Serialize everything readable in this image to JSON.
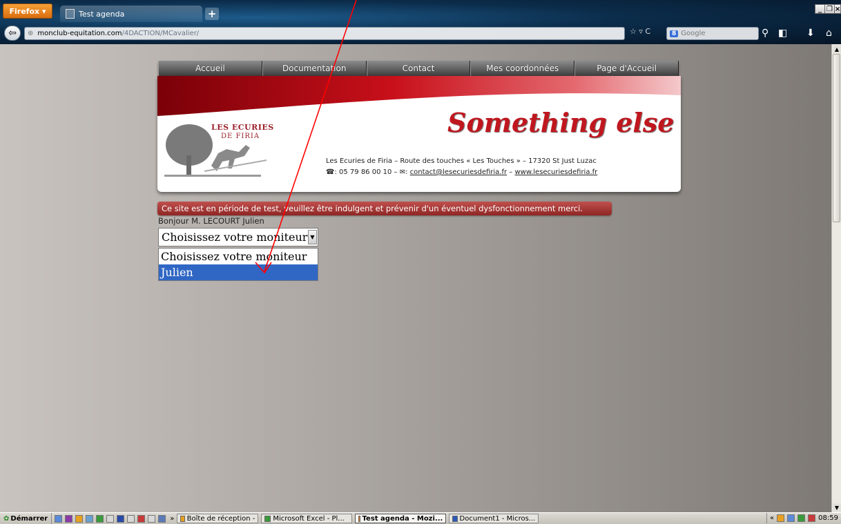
{
  "browser": {
    "menu_button": "Firefox",
    "tab_title": "Test agenda",
    "url_domain": "monclub-equitation.com",
    "url_path": "/4DACTION/MCavalier/",
    "search_placeholder": "Google"
  },
  "nav": {
    "items": [
      "Accueil",
      "Documentation",
      "Contact",
      "Mes coordonnées",
      "Page d'Accueil"
    ]
  },
  "banner": {
    "logo_line1": "LES ECURIES",
    "logo_line2": "DE FIRIA",
    "slogan": "Something else",
    "address": "Les Ecuries de Firia – Route des touches « Les Touches » – 17320 St Just Luzac",
    "phone": ": 05 79 86 00 10 – ",
    "email": "contact@lesecuriesdefiria.fr",
    "dash": " – ",
    "website": "www.lesecuriesdefiria.fr"
  },
  "notice": "Ce site est en période de test, veuillez être indulgent et prévenir d'un éventuel dysfonctionnement merci.",
  "greeting": "Bonjour M. LECOURT Julien",
  "select": {
    "value": "Choisissez votre moniteur",
    "options": [
      "Choisissez votre moniteur",
      "Julien"
    ],
    "selected_index": 1
  },
  "taskbar": {
    "start": "Démarrer",
    "overflow": "»",
    "tasks": [
      "Boîte de réception -",
      "Microsoft Excel - Pl...",
      "Test agenda - Mozi...",
      "Document1 - Micros..."
    ],
    "active_task_index": 2,
    "tray_overflow": "«",
    "clock": "08:59"
  },
  "colors": {
    "accent_red": "#c0171f",
    "highlight_blue": "#3067c4",
    "annotation_arrow": "#ff0000"
  }
}
